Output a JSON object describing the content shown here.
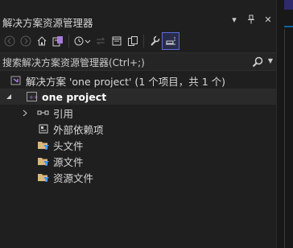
{
  "panel": {
    "title": "解决方案资源管理器",
    "title_icons": [
      "dropdown-arrow",
      "pin",
      "close"
    ]
  },
  "toolbar": {
    "buttons": [
      "back",
      "forward",
      "home",
      "switch-views",
      "pending-changes-filter",
      "sync",
      "collapse-all",
      "show-all-files",
      "properties",
      "preview-selected-items"
    ]
  },
  "search": {
    "placeholder": "搜索解决方案资源管理器(Ctrl+;)"
  },
  "tree": {
    "solution": "解决方案 'one project' (1 个项目，共 1 个)",
    "project": "one project",
    "items": [
      {
        "label": "引用",
        "icon": "references-icon"
      },
      {
        "label": "外部依赖项",
        "icon": "external-dependencies-icon"
      },
      {
        "label": "头文件",
        "icon": "filter-folder-icon"
      },
      {
        "label": "源文件",
        "icon": "filter-folder-icon"
      },
      {
        "label": "资源文件",
        "icon": "filter-folder-icon"
      }
    ]
  },
  "colors": {
    "background": "#1f1f1f",
    "text": "#cccccc",
    "folder": "#dcb67a",
    "accent": "#5a6bd8"
  }
}
